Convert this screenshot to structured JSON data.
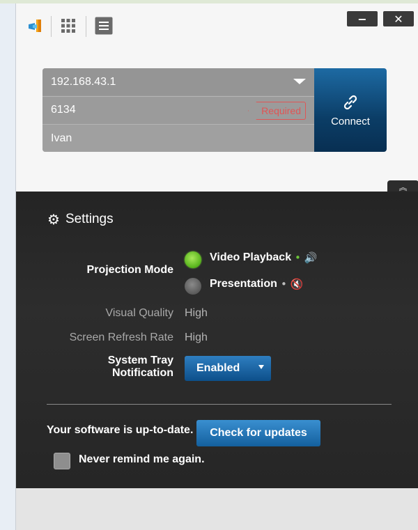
{
  "toolbar": {
    "app_icon": "app-logo-icon",
    "grid_icon": "grid-icon",
    "menu_icon": "menu-icon",
    "minimize_label": "−",
    "close_label": "✕"
  },
  "connection": {
    "ip_value": "192.168.43.1",
    "port_value": "6134",
    "required_label": "Required",
    "name_value": "Ivan",
    "connect_label": "Connect",
    "connect_icon": "link-icon"
  },
  "collapse": {
    "label": "︽"
  },
  "settings": {
    "title": "Settings",
    "title_icon": "gears-icon",
    "projection_mode_label": "Projection Mode",
    "options": [
      {
        "label": "Video Playback",
        "selected": true,
        "suffix": "• 🔊",
        "suffix_color": "#6cc43a"
      },
      {
        "label": "Presentation",
        "selected": false,
        "suffix": "• 🔇",
        "suffix_color": "#bdbdbd"
      }
    ],
    "visual_quality_label": "Visual Quality",
    "visual_quality_value": "High",
    "refresh_rate_label": "Screen Refresh Rate",
    "refresh_rate_value": "High",
    "tray_label_line1": "System Tray",
    "tray_label_line2": "Notification",
    "tray_value": "Enabled",
    "update_status": "Your software is up-to-date.",
    "check_updates_label": "Check for updates",
    "never_remind_label": "Never remind me again."
  },
  "colors": {
    "accent_blue": "#1d6aa3",
    "panel_dark": "#262626",
    "required_red": "#e05555",
    "active_green": "#6cc43a"
  }
}
